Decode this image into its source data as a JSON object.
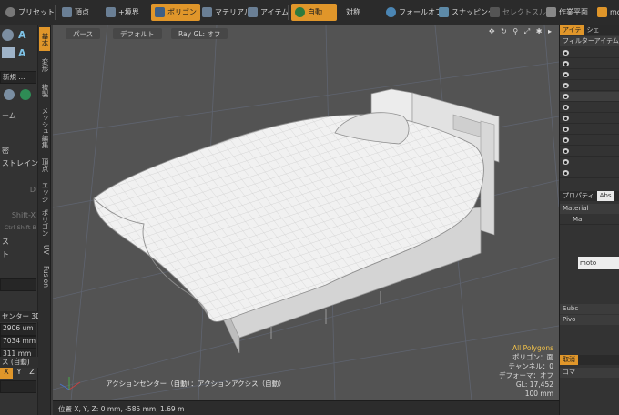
{
  "toolbar": {
    "preset": "プリセット",
    "vertex": "頂点",
    "boundary": "+境界",
    "polygon": "ポリゴン",
    "material": "マテリアル",
    "item": "アイテム",
    "auto": "自動",
    "symmetry": "対称",
    "falloff": "フォールオフ",
    "snapping": "スナッピング",
    "select_through": "セレクトスルー",
    "work_plane": "作業平面",
    "mo": "mo"
  },
  "left_panel": {
    "new": "新規 ...",
    "item_cut": "ーム",
    "density": "密",
    "constraint": "ストレイント",
    "d_key": "D",
    "shift_x": "Shift-X",
    "ctrl_shift_b": "Ctrl-Shift-B",
    "su": "ス",
    "to": "ト",
    "action_center": "センター 3D",
    "x_value": "2906 um",
    "y_value": "7034 mm",
    "z_value": "311 mm",
    "axis_label": "ス (自動)",
    "axis_x": "X",
    "axis_y": "Y",
    "axis_z": "Z"
  },
  "vertical_tabs": [
    "基本",
    "変形",
    "複製",
    "メッシュ編集",
    "頂点",
    "エッジ",
    "ポリゴン",
    "UV",
    "Fusion"
  ],
  "viewport": {
    "tab_perspective": "パース",
    "tab_default": "デフォルト",
    "tab_raygl": "Ray GL: オフ",
    "nav_icons": "✥ ↻ ⚲ ⤢ ✱ ▸",
    "hud_all_polygons": "All Polygons",
    "hud_polygon": "ポリゴン：面",
    "hud_channel": "チャンネル：0",
    "hud_deformer": "デフォーマ：オフ",
    "hud_gl": "GL: 17,452",
    "hud_scale": "100 mm",
    "action_center_info": "アクションセンター（自動）：アクションアクシス（自動）"
  },
  "status": {
    "position": "位置 X, Y, Z:   0 mm, -585 mm, 1.69 m"
  },
  "right_panel": {
    "tab_item": "アイテ",
    "tab_other": "シェ",
    "filter": "フィルターアイテム",
    "properties": "プロパティ",
    "abs_label": "Abs",
    "material_label": "Material",
    "ma_label": "Ma",
    "moto_label": "moto",
    "sub_label": "Subc",
    "pivot_label": "Pivo",
    "bottom_tab": "取消",
    "bottom_com": "コマ"
  },
  "colors": {
    "accent": "#e0962a",
    "viewport_bg": "#535353",
    "panel_bg": "#333333",
    "mesh_fill": "#efefef"
  }
}
